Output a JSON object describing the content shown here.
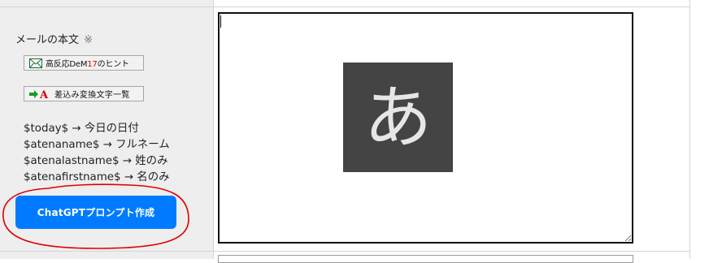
{
  "form": {
    "label": "メールの本文",
    "required_mark": "※"
  },
  "hint_button": {
    "text_before": "高反応DeM",
    "text_em": "17",
    "text_after": "のヒント",
    "icon": "envelope-icon"
  },
  "replace_button": {
    "label": "差込み変換文字一覧",
    "icon": "arrow-A-icon",
    "icon_letter": "A"
  },
  "variables": [
    "$today$ → 今日の日付",
    "$atenaname$ → フルネーム",
    "$atenalastname$ → 姓のみ",
    "$atenafirstname$ → 名のみ"
  ],
  "gpt_button": {
    "label": "ChatGPTプロンプト作成"
  },
  "body_textarea": {
    "value": ""
  },
  "ime_indicator": {
    "char": "あ"
  },
  "colors": {
    "primary_button": "#007bff",
    "annotation_circle": "#e00000",
    "ime_background": "#444444"
  }
}
